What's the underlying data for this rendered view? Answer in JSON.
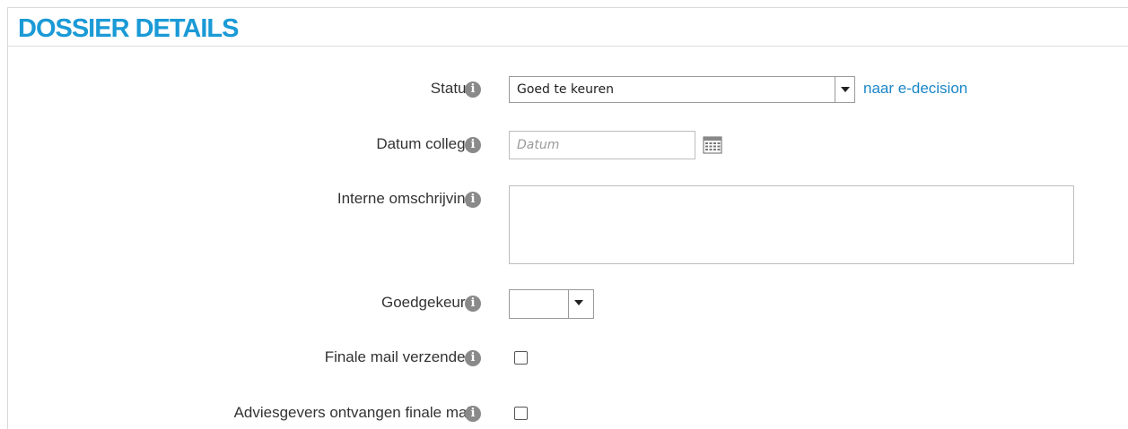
{
  "panel": {
    "title": "DOSSIER DETAILS"
  },
  "fields": {
    "status": {
      "label": "Status",
      "value": "Goed te keuren",
      "link": "naar e-decision"
    },
    "datum_college": {
      "label": "Datum college",
      "placeholder": "Datum"
    },
    "interne_omschrijving": {
      "label": "Interne omschrijving",
      "value": ""
    },
    "goedgekeurd": {
      "label": "Goedgekeurd",
      "value": ""
    },
    "finale_mail_verzenden": {
      "label": "Finale mail verzenden",
      "checked": false
    },
    "adviesgevers_finale_mail": {
      "label": "Adviesgevers ontvangen finale mail",
      "checked": false
    }
  },
  "icons": {
    "info": "i"
  },
  "colors": {
    "title": "#1a9ad6",
    "link": "#1a86c8",
    "info_icon_bg": "#8a8a8a"
  }
}
